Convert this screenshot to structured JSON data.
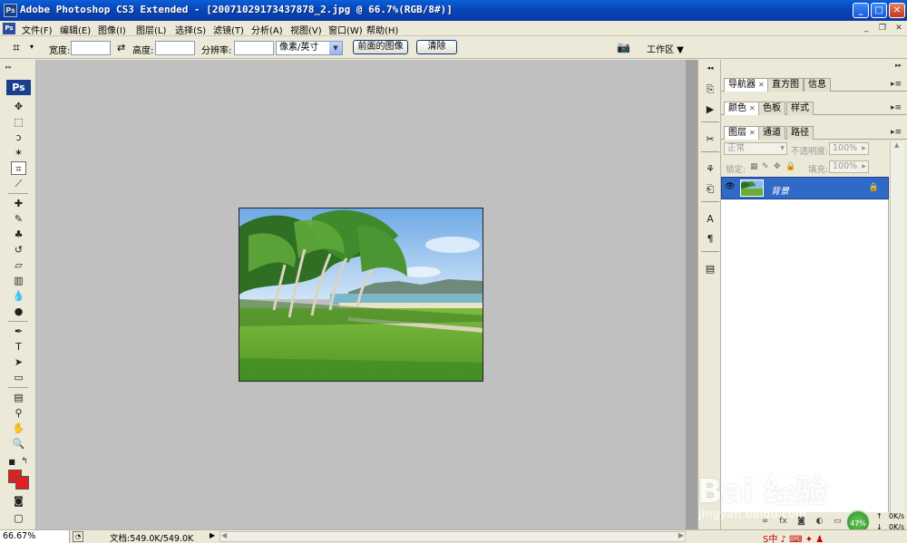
{
  "window": {
    "icon_text": "Ps",
    "title": "Adobe Photoshop CS3 Extended - [20071029173437878_2.jpg @ 66.7%(RGB/8#)]",
    "minimize": "_",
    "maximize": "□",
    "close": "✕"
  },
  "menubar": {
    "ps_icon": "Ps",
    "items": [
      "文件(F)",
      "编辑(E)",
      "图像(I)",
      "图层(L)",
      "选择(S)",
      "滤镜(T)",
      "分析(A)",
      "视图(V)",
      "窗口(W)",
      "帮助(H)"
    ],
    "doc_min": "_",
    "doc_restore": "❐",
    "doc_close": "✕"
  },
  "options": {
    "width_label": "宽度:",
    "width_value": "",
    "height_label": "高度:",
    "height_value": "",
    "resolution_label": "分辨率:",
    "resolution_value": "",
    "unit_selected": "像素/英寸",
    "front_image_button": "前面的图像",
    "clear_button": "清除",
    "workspace_label": "工作区"
  },
  "toolbox": {
    "ps_logo": "Ps",
    "icons": [
      "move-icon",
      "marquee-icon",
      "lasso-icon",
      "magic-wand-icon",
      "crop-icon",
      "slice-icon",
      "healing-brush-icon",
      "brush-icon",
      "clone-stamp-icon",
      "history-brush-icon",
      "eraser-icon",
      "gradient-icon",
      "blur-icon",
      "dodge-icon",
      "pen-icon",
      "type-icon",
      "path-selection-icon",
      "rectangle-icon",
      "notes-icon",
      "eyedropper-icon",
      "hand-icon",
      "zoom-icon"
    ],
    "foreground_color": "#e41f1f",
    "background_color": "#e41f1f"
  },
  "panels": {
    "group1_tabs": [
      "导航器",
      "直方图",
      "信息"
    ],
    "group2_tabs": [
      "颜色",
      "色板",
      "样式"
    ],
    "group3_tabs": [
      "图层",
      "通道",
      "路径"
    ],
    "blend_mode": "正常",
    "opacity_label": "不透明度:",
    "opacity_value": "100%",
    "lock_label": "锁定:",
    "fill_label": "填充:",
    "fill_value": "100%",
    "layer_name": "背景"
  },
  "status": {
    "zoom": "66.67%",
    "doc_info": "文档:549.0K/549.0K"
  },
  "watermark": {
    "logo_text": "Bai 经验",
    "url": "jingyan.baidu.com"
  },
  "tray": {
    "cpu_badge": "47%",
    "up_speed": "0K/s",
    "down_speed": "0K/s",
    "ime": "S中 ♪ ⌨ ✦ ♟"
  }
}
